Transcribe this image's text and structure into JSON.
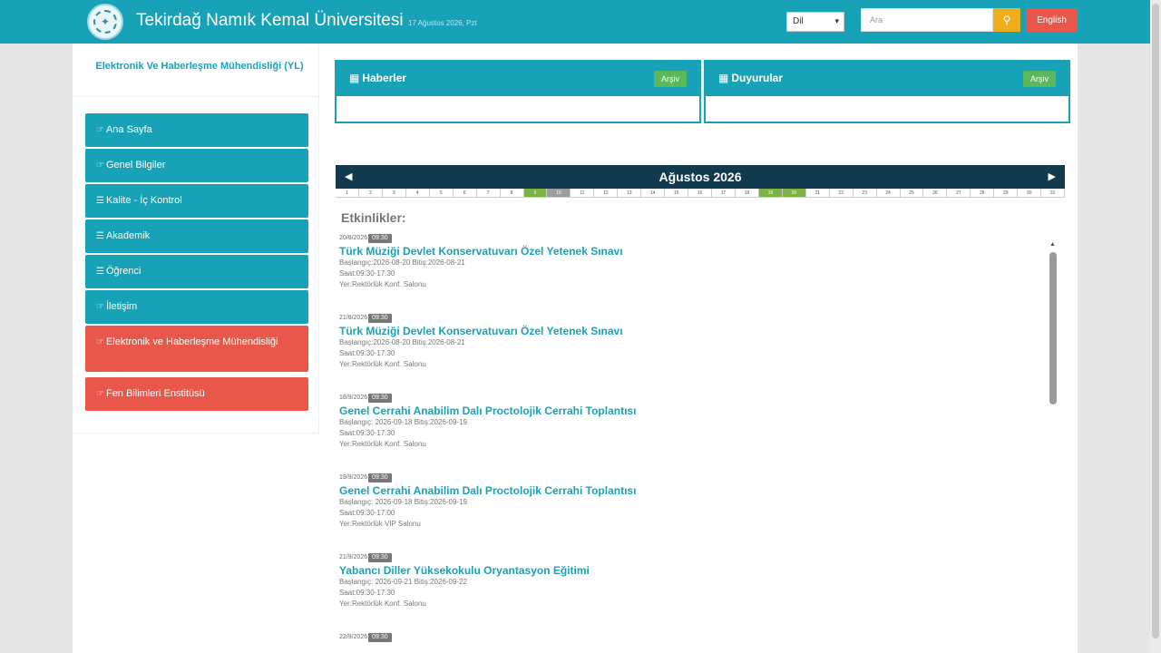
{
  "header": {
    "title": "Tekirdağ Namık Kemal Üniversitesi",
    "date": "17 Ağustos 2026, Pzt",
    "language": {
      "selected": "Dil"
    },
    "search": {
      "placeholder": "Ara"
    },
    "english_label": "English"
  },
  "sidebar": {
    "department": "Elektronik Ve Haberleşme Mühendisliği (YL)",
    "items": [
      {
        "label": "Ana Sayfa",
        "icon": "hand-pointer-icon",
        "color": "#17a2b8"
      },
      {
        "label": "Genel Bilgiler",
        "icon": "hand-pointer-icon",
        "color": "#17a2b8"
      },
      {
        "label": "Kalite - İç Kontrol",
        "icon": "list-icon",
        "color": "#17a2b8"
      },
      {
        "label": "Akademik",
        "icon": "list-icon",
        "color": "#17a2b8"
      },
      {
        "label": "Öğrenci",
        "icon": "list-icon",
        "color": "#17a2b8"
      },
      {
        "label": "İletişim",
        "icon": "hand-pointer-icon",
        "color": "#17a2b8"
      },
      {
        "label": "Elektronik ve Haberleşme Mühendisliği",
        "icon": "hand-pointer-icon",
        "color": "#e8574a"
      },
      {
        "label": "Fen Bilimleri Enstitüsü",
        "icon": "hand-pointer-icon",
        "color": "#e8574a"
      }
    ]
  },
  "panels": {
    "news": {
      "title": "Haberler",
      "archive": "Arşiv"
    },
    "announcements": {
      "title": "Duyurular",
      "archive": "Arşiv"
    }
  },
  "calendar": {
    "title": "Ağustos 2026",
    "days": [
      "1",
      "2",
      "3",
      "4",
      "5",
      "6",
      "7",
      "8",
      "9",
      "10",
      "11",
      "12",
      "13",
      "14",
      "15",
      "16",
      "17",
      "18",
      "19",
      "20",
      "21",
      "22",
      "23",
      "24",
      "25",
      "26",
      "27",
      "28",
      "29",
      "30",
      "31"
    ],
    "highlighted_days": [
      "9",
      "19",
      "20"
    ],
    "today": "10"
  },
  "events": {
    "heading": "Etkinlikler:",
    "items": [
      {
        "date": "20/8/2026",
        "time": "09:30",
        "title": "Türk Müziği Devlet Konservatuvarı Özel Yetenek Sınavı",
        "dates": "Başlangıç:2026-08-20 Bitiş:2026-08-21",
        "hours": "Saat:09:30-17:30",
        "place": "Yer:Rektörlük Konf. Salonu"
      },
      {
        "date": "21/8/2026",
        "time": "09:30",
        "title": "Türk Müziği Devlet Konservatuvarı Özel Yetenek Sınavı",
        "dates": "Başlangıç:2026-08-20 Bitiş:2026-08-21",
        "hours": "Saat:09:30-17:30",
        "place": "Yer:Rektörlük Konf. Salonu"
      },
      {
        "date": "18/9/2026",
        "time": "09:30",
        "title": "Genel Cerrahi Anabilim Dalı Proctolojik Cerrahi Toplantısı",
        "dates": "Başlangıç: 2026-09-18 Bitiş:2026-09-19",
        "hours": "Saat:09:30-17:30",
        "place": "Yer:Rektörlük Konf. Salonu"
      },
      {
        "date": "19/9/2026",
        "time": "09:30",
        "title": "Genel Cerrahi Anabilim Dalı Proctolojik Cerrahi Toplantısı",
        "dates": "Başlangıç: 2026-09-18 Bitiş:2026-09-19",
        "hours": "Saat:09:30-17:00",
        "place": "Yer:Rektörlük VİP Salonu"
      },
      {
        "date": "21/9/2026",
        "time": "09:30",
        "title": "Yabancı Diller Yüksekokulu Oryantasyon Eğitimi",
        "dates": "Başlangıç: 2026-09-21 Bitiş:2026-09-22",
        "hours": "Saat:09:30-17:30",
        "place": "Yer:Rektörlük Konf. Salonu"
      },
      {
        "date": "22/9/2026",
        "time": "09:30",
        "title": "",
        "dates": "",
        "hours": "",
        "place": ""
      }
    ]
  }
}
